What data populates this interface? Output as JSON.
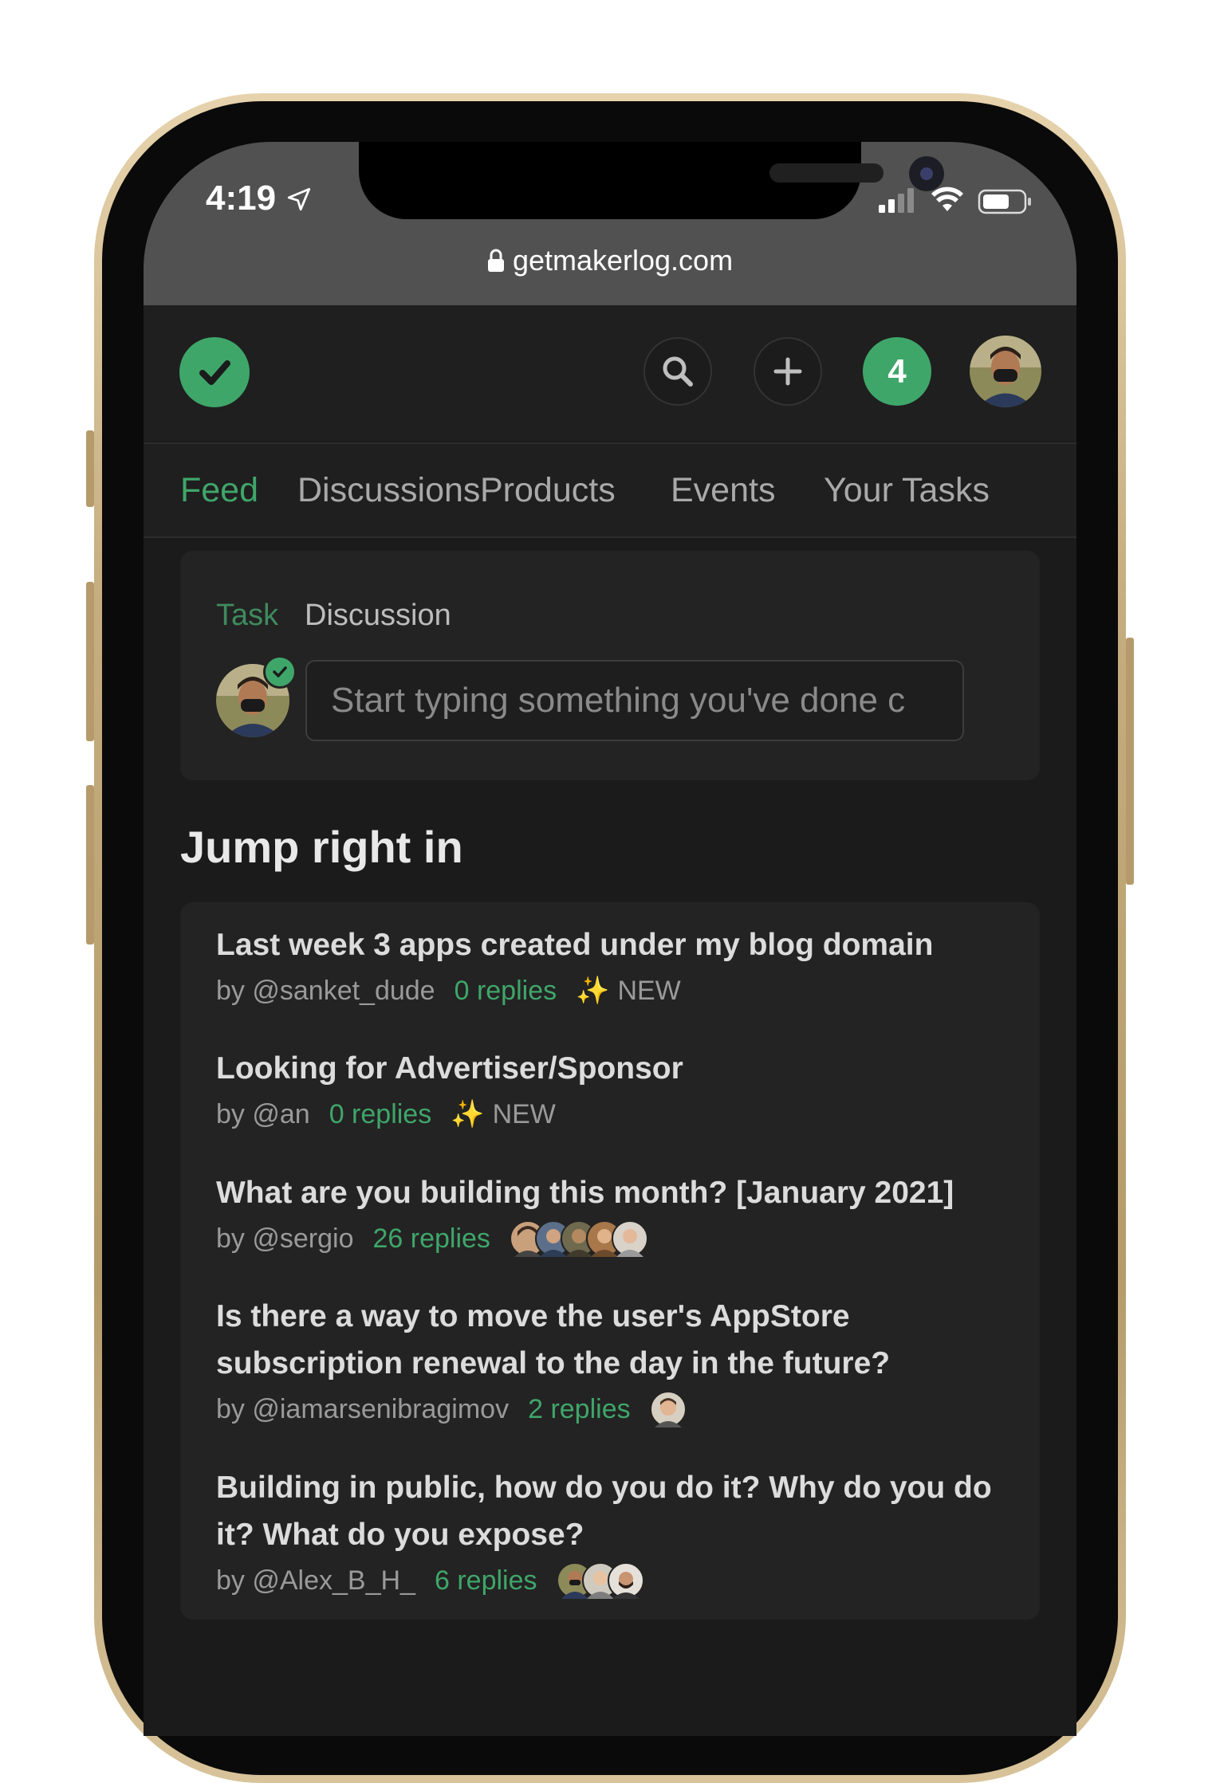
{
  "status_bar": {
    "time": "4:19",
    "url": "getmakerlog.com"
  },
  "header": {
    "notification_count": "4",
    "icons": [
      "check-logo-icon",
      "search-icon",
      "plus-icon",
      "avatar"
    ]
  },
  "nav": {
    "tabs": [
      {
        "label": "Feed",
        "active": true
      },
      {
        "label": "Discussions",
        "active": false
      },
      {
        "label": "Products",
        "active": false
      },
      {
        "label": "Events",
        "active": false
      },
      {
        "label": "Your Tasks",
        "active": false
      }
    ]
  },
  "composer": {
    "tab_task": "Task",
    "tab_discussion": "Discussion",
    "placeholder": "Start typing something you've done c"
  },
  "section_title": "Jump right in",
  "discussions": [
    {
      "title": "Last week 3 apps created under my blog domain",
      "author": "by @sanket_dude",
      "replies": "0 replies",
      "new_label": "NEW"
    },
    {
      "title": "Looking for Advertiser/Sponsor",
      "author": "by @an",
      "replies": "0 replies",
      "new_label": "NEW"
    },
    {
      "title": "What are you building this month? [January 2021]",
      "author": "by @sergio",
      "replies": "26 replies",
      "new_label": ""
    },
    {
      "title": "Is there a way to move the user's AppStore subscription renewal to the day in the future?",
      "author": "by @iamarsenibragimov",
      "replies": "2 replies",
      "new_label": ""
    },
    {
      "title": "Building in public, how do you do it? Why do you do it? What do you expose?",
      "author": "by @Alex_B_H_",
      "replies": "6 replies",
      "new_label": ""
    }
  ],
  "colors": {
    "accent": "#3fa66a",
    "background": "#1b1b1b",
    "card": "#232323",
    "status_bar": "#515151"
  }
}
